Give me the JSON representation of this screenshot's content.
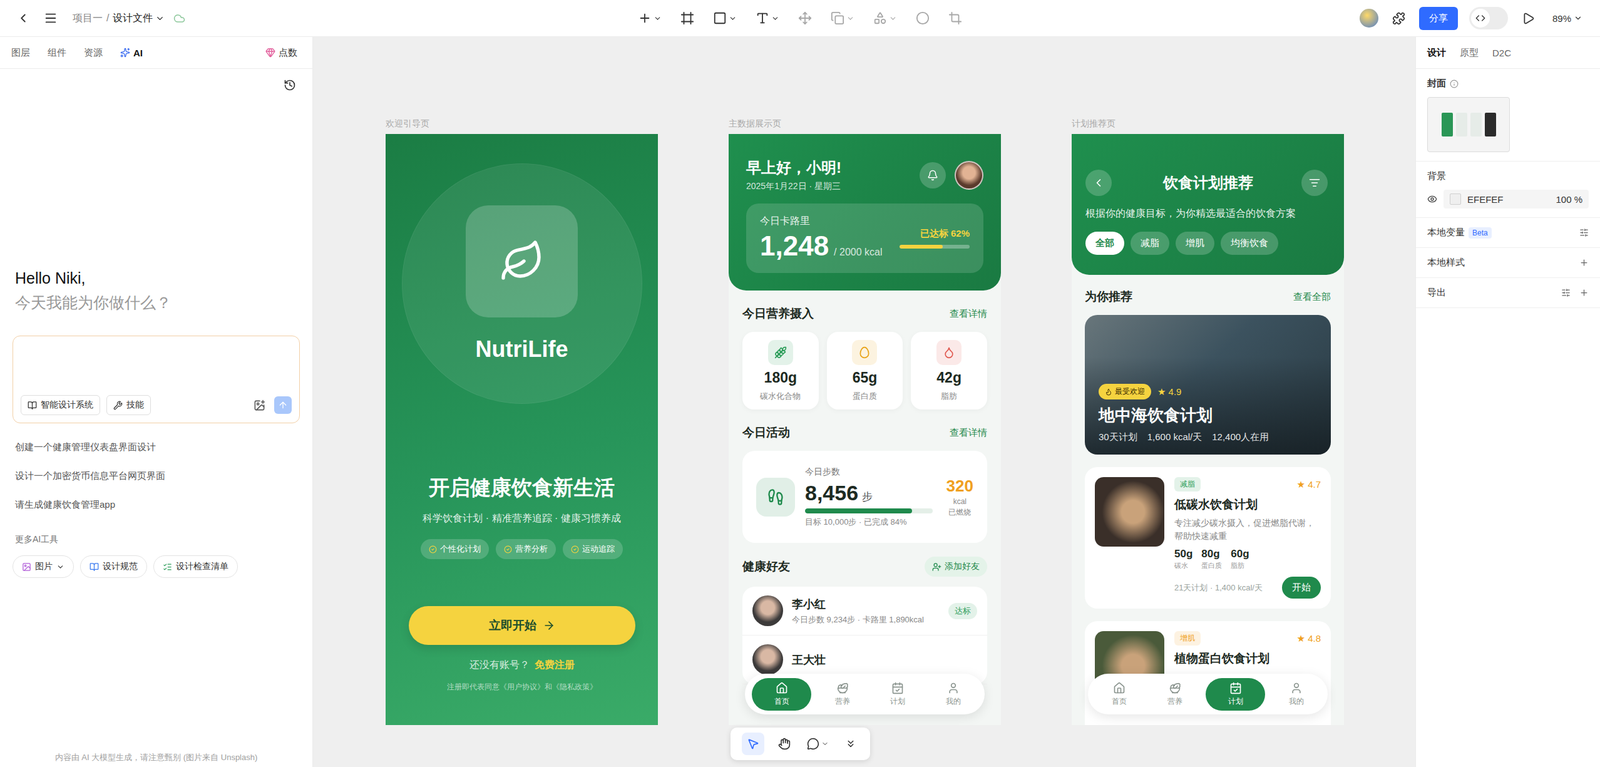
{
  "topbar": {
    "breadcrumb": {
      "project": "项目一",
      "separator": "/",
      "file": "设计文件"
    },
    "share": "分享",
    "zoom": "89%"
  },
  "left_panel": {
    "tabs": [
      {
        "label": "图层",
        "selected": false
      },
      {
        "label": "组件",
        "selected": false
      },
      {
        "label": "资源",
        "selected": false
      },
      {
        "label": "AI",
        "selected": true
      }
    ],
    "points": "点数",
    "greeting": {
      "title": "Hello Niki,",
      "subtitle": "今天我能为你做什么？"
    },
    "prompt_buttons": [
      "智能设计系统",
      "技能"
    ],
    "suggestions": [
      "创建一个健康管理仪表盘界面设计",
      "设计一个加密货币信息平台网页界面",
      "请生成健康饮食管理app"
    ],
    "more_tools": {
      "title": "更多AI工具",
      "items": [
        {
          "label": "图片",
          "dropdown": true
        },
        {
          "label": "设计规范",
          "dropdown": false
        },
        {
          "label": "设计检查清单",
          "dropdown": false
        }
      ]
    },
    "footer": "内容由 AI 大模型生成，请注意甄别 (图片来自 Unsplash)"
  },
  "welcome_frame": {
    "label": "欢迎引导页",
    "app_name": "NutriLife",
    "headline": "开启健康饮食新生活",
    "tagline": "科学饮食计划 · 精准营养追踪 · 健康习惯养成",
    "features": [
      "个性化计划",
      "营养分析",
      "运动追踪"
    ],
    "cta": "立即开始",
    "signup_prompt": "还没有账号？",
    "signup_link": "免费注册",
    "terms": "注册即代表同意《用户协议》和《隐私政策》"
  },
  "dashboard_frame": {
    "label": "主数据展示页",
    "greeting": "早上好，小明!",
    "date": "2025年1月22日 · 星期三",
    "calories": {
      "title": "今日卡路里",
      "value": "1,248",
      "goal": "/ 2000 kcal",
      "status": "已达标 62%",
      "level": 0.62
    },
    "nutrition": {
      "title": "今日营养摄入",
      "link": "查看详情",
      "items": [
        {
          "value": "180g",
          "label": "碳水化合物",
          "color": "#2e9e5b"
        },
        {
          "value": "65g",
          "label": "蛋白质",
          "color": "#e8a317"
        },
        {
          "value": "42g",
          "label": "脂肪",
          "color": "#e0584f"
        }
      ]
    },
    "activity": {
      "title": "今日活动",
      "link": "查看详情",
      "steps_label": "今日步数",
      "steps": "8,456",
      "steps_unit": "步",
      "level": 0.84,
      "goal": "目标 10,000步 · 已完成 84%",
      "burned": "320",
      "burned_unit": "kcal",
      "burned_label": "已燃烧"
    },
    "friends": {
      "title": "健康好友",
      "action": "添加好友",
      "items": [
        {
          "name": "李小红",
          "detail": "今日步数 9,234步 · 卡路里 1,890kcal",
          "status": "达标",
          "color": "#2e9e5b"
        },
        {
          "name": "王大壮"
        }
      ]
    },
    "nav": [
      {
        "label": "首页",
        "selected": true
      },
      {
        "label": "营养",
        "selected": false
      },
      {
        "label": "计划",
        "selected": false
      },
      {
        "label": "我的",
        "selected": false
      }
    ]
  },
  "plans_frame": {
    "label": "计划推荐页",
    "title": "饮食计划推荐",
    "subtitle": "根据你的健康目标，为你精选最适合的饮食方案",
    "filters": [
      {
        "label": "全部",
        "selected": true
      },
      {
        "label": "减脂",
        "selected": false
      },
      {
        "label": "增肌",
        "selected": false
      },
      {
        "label": "均衡饮食",
        "selected": false
      }
    ],
    "section": {
      "title": "为你推荐",
      "link": "查看全部"
    },
    "featured": {
      "badge": "最受欢迎",
      "rating": "★ 4.9",
      "title": "地中海饮食计划",
      "meta": [
        "30天计划",
        "1,600 kcal/天",
        "12,400人在用"
      ]
    },
    "plans": [
      {
        "tag": "减脂",
        "tag_color": "#2e9e5b",
        "rating": "★ 4.7",
        "title": "低碳水饮食计划",
        "desc": "专注减少碳水摄入，促进燃脂代谢，帮助快速减重",
        "macros": [
          {
            "value": "50g",
            "label": "碳水"
          },
          {
            "value": "80g",
            "label": "蛋白质"
          },
          {
            "value": "60g",
            "label": "脂肪"
          }
        ],
        "meta": "21天计划 · 1,400 kcal/天",
        "action": "开始"
      },
      {
        "tag": "增肌",
        "tag_color": "#f0a020",
        "rating": "★ 4.8",
        "title": "植物蛋白饮食计划"
      }
    ],
    "nav": [
      {
        "label": "首页",
        "selected": false
      },
      {
        "label": "营养",
        "selected": false
      },
      {
        "label": "计划",
        "selected": true
      },
      {
        "label": "我的",
        "selected": false
      }
    ]
  },
  "right_panel": {
    "tabs": [
      {
        "label": "设计",
        "selected": true
      },
      {
        "label": "原型",
        "selected": false
      },
      {
        "label": "D2C",
        "selected": false
      }
    ],
    "cover": {
      "title": "封面"
    },
    "background": {
      "title": "背景",
      "visible": true,
      "hex": "EFEFEF",
      "swatch": "#EFEFEF",
      "opacity": "100 %"
    },
    "sections": [
      {
        "title": "本地变量",
        "badge": "Beta",
        "kind": "settings"
      },
      {
        "title": "本地样式",
        "kind": "add"
      },
      {
        "title": "导出",
        "kind": "settings-add"
      }
    ]
  }
}
